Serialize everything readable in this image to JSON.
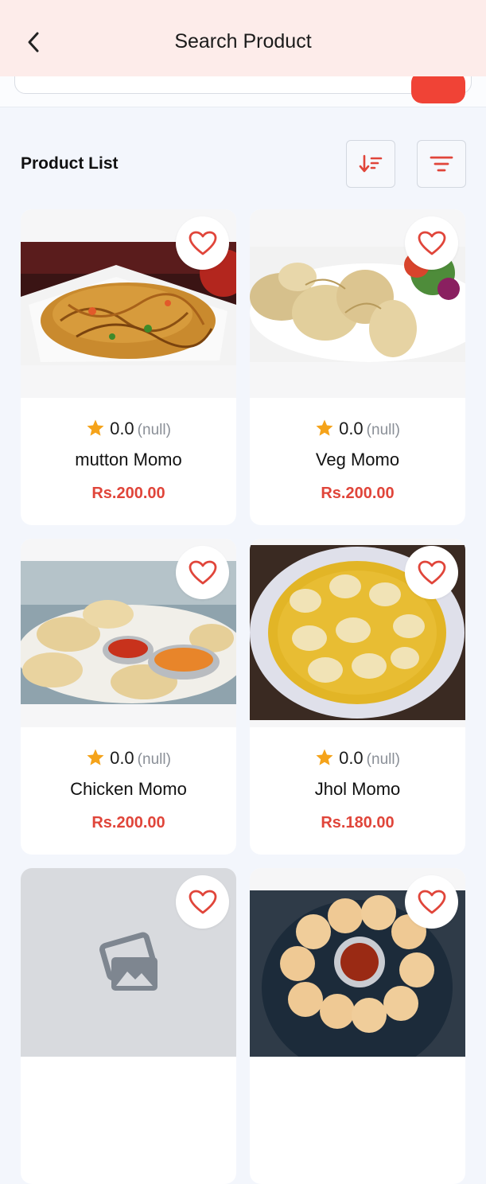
{
  "header": {
    "title": "Search Product",
    "back_icon": "chevron-left-icon"
  },
  "search": {
    "button_color": "#f04336"
  },
  "list": {
    "title": "Product List",
    "sort_icon": "sort-descending-icon",
    "filter_icon": "filter-icon"
  },
  "colors": {
    "accent": "#e0453a",
    "star": "#f5a31a",
    "header_bg": "#fdecea"
  },
  "products": [
    {
      "name": "mutton Momo",
      "rating": "0.0",
      "count": "(null)",
      "price": "Rs.200.00",
      "image": "chowmein-plate"
    },
    {
      "name": "Veg Momo",
      "rating": "0.0",
      "count": "(null)",
      "price": "Rs.200.00",
      "image": "steamed-momo-plate"
    },
    {
      "name": "Chicken Momo",
      "rating": "0.0",
      "count": "(null)",
      "price": "Rs.200.00",
      "image": "momo-with-sauces"
    },
    {
      "name": "Jhol Momo",
      "rating": "0.0",
      "count": "(null)",
      "price": "Rs.180.00",
      "image": "momo-soup-bowl"
    },
    {
      "name": "",
      "rating": "",
      "count": "",
      "price": "",
      "image": "image-placeholder"
    },
    {
      "name": "",
      "rating": "",
      "count": "",
      "price": "",
      "image": "momo-ring-with-chutney"
    }
  ]
}
